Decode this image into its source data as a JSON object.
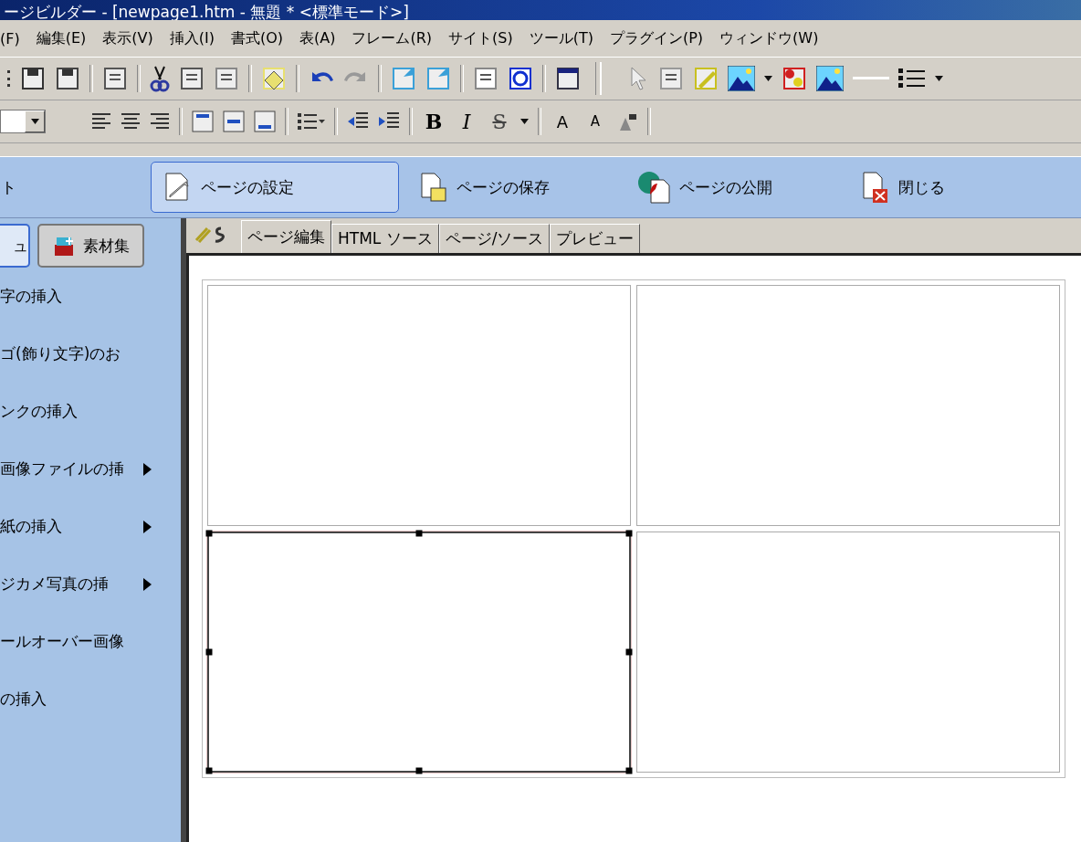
{
  "window": {
    "title": "ージビルダー - [newpage1.htm - 無題 * <標準モード>]"
  },
  "menu": [
    "(F)",
    "編集(E)",
    "表示(V)",
    "挿入(I)",
    "書式(O)",
    "表(A)",
    "フレーム(R)",
    "サイト(S)",
    "ツール(T)",
    "プラグイン(P)",
    "ウィンドウ(W)"
  ],
  "format_toolbar": {
    "text_buttons": [
      {
        "label": "B",
        "kind": "bold"
      },
      {
        "label": "I",
        "kind": "italic"
      },
      {
        "label": "S",
        "kind": "strike"
      },
      {
        "label": "A",
        "kind": "grow"
      },
      {
        "label": "A",
        "kind": "shrink"
      }
    ]
  },
  "action_bar": [
    {
      "label": "ト",
      "kind": "cut",
      "selected": false
    },
    {
      "label": "ページの設定",
      "kind": "settings",
      "selected": true
    },
    {
      "label": "ページの保存",
      "kind": "save",
      "selected": false
    },
    {
      "label": "ページの公開",
      "kind": "publish",
      "selected": false
    },
    {
      "label": "閉じる",
      "kind": "close",
      "selected": false
    }
  ],
  "side_tabs": [
    {
      "label": "ュ",
      "selected": true
    },
    {
      "label": "素材集",
      "selected": false
    }
  ],
  "side_items": [
    {
      "label": "字の挿入",
      "submenu": false
    },
    {
      "label": "ゴ(飾り文字)のお",
      "submenu": false
    },
    {
      "label": "ンクの挿入",
      "submenu": false
    },
    {
      "label": "画像ファイルの挿",
      "submenu": true
    },
    {
      "label": "紙の挿入",
      "submenu": true
    },
    {
      "label": "ジカメ写真の挿",
      "submenu": true
    },
    {
      "label": "ールオーバー画像",
      "submenu": false
    },
    {
      "label": "の挿入",
      "submenu": false
    }
  ],
  "editor_tabs": [
    {
      "label": "ページ編集",
      "selected": true
    },
    {
      "label": "HTML ソース",
      "selected": false
    },
    {
      "label": "ページ/ソース",
      "selected": false
    },
    {
      "label": "プレビュー",
      "selected": false
    }
  ],
  "table": {
    "rows": [
      [
        {
          "selected": false
        },
        {
          "selected": false
        }
      ],
      [
        {
          "selected": true
        },
        {
          "selected": false
        }
      ]
    ]
  }
}
